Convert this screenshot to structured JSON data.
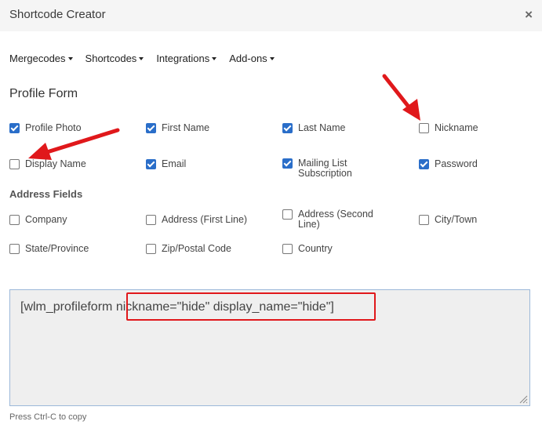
{
  "window": {
    "title": "Shortcode Creator",
    "close_symbol": "×"
  },
  "menu": {
    "items": [
      "Mergecodes",
      "Shortcodes",
      "Integrations",
      "Add-ons"
    ]
  },
  "profile_form": {
    "title": "Profile Form",
    "fields": [
      {
        "label": "Profile Photo",
        "checked": true
      },
      {
        "label": "First Name",
        "checked": true
      },
      {
        "label": "Last Name",
        "checked": true
      },
      {
        "label": "Nickname",
        "checked": false
      },
      {
        "label": "Display Name",
        "checked": false
      },
      {
        "label": "Email",
        "checked": true
      },
      {
        "label": "Mailing List Subscription",
        "checked": true
      },
      {
        "label": "Password",
        "checked": true
      }
    ]
  },
  "address_fields": {
    "title": "Address Fields",
    "fields": [
      {
        "label": "Company",
        "checked": false
      },
      {
        "label": "Address (First Line)",
        "checked": false
      },
      {
        "label": "Address (Second Line)",
        "checked": false
      },
      {
        "label": "City/Town",
        "checked": false
      },
      {
        "label": "State/Province",
        "checked": false
      },
      {
        "label": "Zip/Postal Code",
        "checked": false
      },
      {
        "label": "Country",
        "checked": false
      }
    ]
  },
  "shortcode": {
    "prefix": "[wlm_profileform ",
    "highlighted": "nickname=\"hide\" display_name=\"hide\"]"
  },
  "hint": "Press Ctrl-C to copy",
  "colors": {
    "checkbox_checked": "#2a6ec9",
    "annotation_red": "#e0181b",
    "header_bg": "#f5f5f5"
  }
}
